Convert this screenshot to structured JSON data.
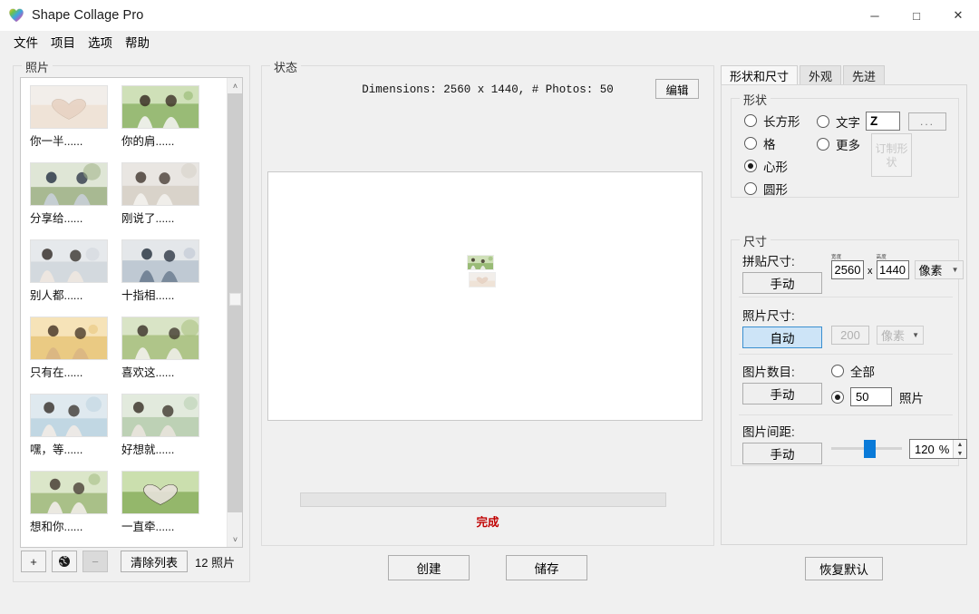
{
  "window": {
    "title": "Shape Collage Pro",
    "icon": "heart-icon",
    "minimize": "─",
    "maximize": "□",
    "close": "✕"
  },
  "menu": {
    "items": [
      "文件",
      "项目",
      "选项",
      "帮助"
    ]
  },
  "photos_panel": {
    "title": "照片",
    "items": [
      {
        "caption": "你一半......",
        "scene": "hands-heart"
      },
      {
        "caption": "你的肩......",
        "scene": "couple-grass"
      },
      {
        "caption": "分享给......",
        "scene": "sharing-phone"
      },
      {
        "caption": "刚说了......",
        "scene": "girl-street"
      },
      {
        "caption": "别人都......",
        "scene": "couple-face"
      },
      {
        "caption": "十指相......",
        "scene": "holding-hands"
      },
      {
        "caption": "只有在......",
        "scene": "sunset-pair"
      },
      {
        "caption": "喜欢这......",
        "scene": "picnic-lap"
      },
      {
        "caption": "嘿，等......",
        "scene": "looking-up"
      },
      {
        "caption": "好想就......",
        "scene": "hug-back"
      },
      {
        "caption": "想和你......",
        "scene": "tree-lean"
      },
      {
        "caption": "一直牵......",
        "scene": "hands-grass"
      }
    ],
    "toolbar": {
      "add_label": "+",
      "web_label": "globe-icon",
      "remove_label": "−",
      "clear_label": "清除列表",
      "count_text": "12 照片"
    },
    "scrollbar": {
      "up": "˄",
      "down": "˅"
    }
  },
  "status_panel": {
    "title": "状态",
    "dimensions_text": "Dimensions: 2560 x 1440, # Photos: 50",
    "edit_label": "编辑",
    "progress_value": 0,
    "done_label": "完成",
    "create_label": "创建",
    "save_label": "储存"
  },
  "settings_panel": {
    "tabs": [
      {
        "label": "形状和尺寸",
        "active": true
      },
      {
        "label": "外观",
        "active": false
      },
      {
        "label": "先进",
        "active": false
      }
    ],
    "shape_group": {
      "title": "形状",
      "options_left": [
        {
          "label": "长方形",
          "selected": false
        },
        {
          "label": "格",
          "selected": false
        },
        {
          "label": "心形",
          "selected": true
        },
        {
          "label": "圆形",
          "selected": false
        }
      ],
      "options_right": [
        {
          "label": "文字",
          "selected": false
        },
        {
          "label": "更多",
          "selected": false
        }
      ],
      "text_value": "Z",
      "browse_label": "...",
      "custom_shape_label": "订制形状"
    },
    "size_group": {
      "title": "尺寸",
      "collage_size": {
        "label": "拼贴尺寸:",
        "mode": "手动",
        "width_label": "宽度",
        "height_label": "高度",
        "width": "2560",
        "separator": "x",
        "height": "1440",
        "unit": "像素"
      },
      "photo_size": {
        "label": "照片尺寸:",
        "mode": "自动",
        "value": "200",
        "unit": "像素"
      },
      "photo_count": {
        "label": "图片数目:",
        "mode": "手动",
        "all_label": "全部",
        "all_selected": false,
        "number_selected": true,
        "number": "50",
        "suffix": "照片"
      },
      "photo_spacing": {
        "label": "图片间距:",
        "mode": "手动",
        "slider_percent": 46,
        "value": "120",
        "unit": "%"
      }
    },
    "restore_label": "恢复默认"
  },
  "collage": {
    "shape": "heart",
    "tile_count": 50,
    "accent_color": "#0a7ad8"
  }
}
